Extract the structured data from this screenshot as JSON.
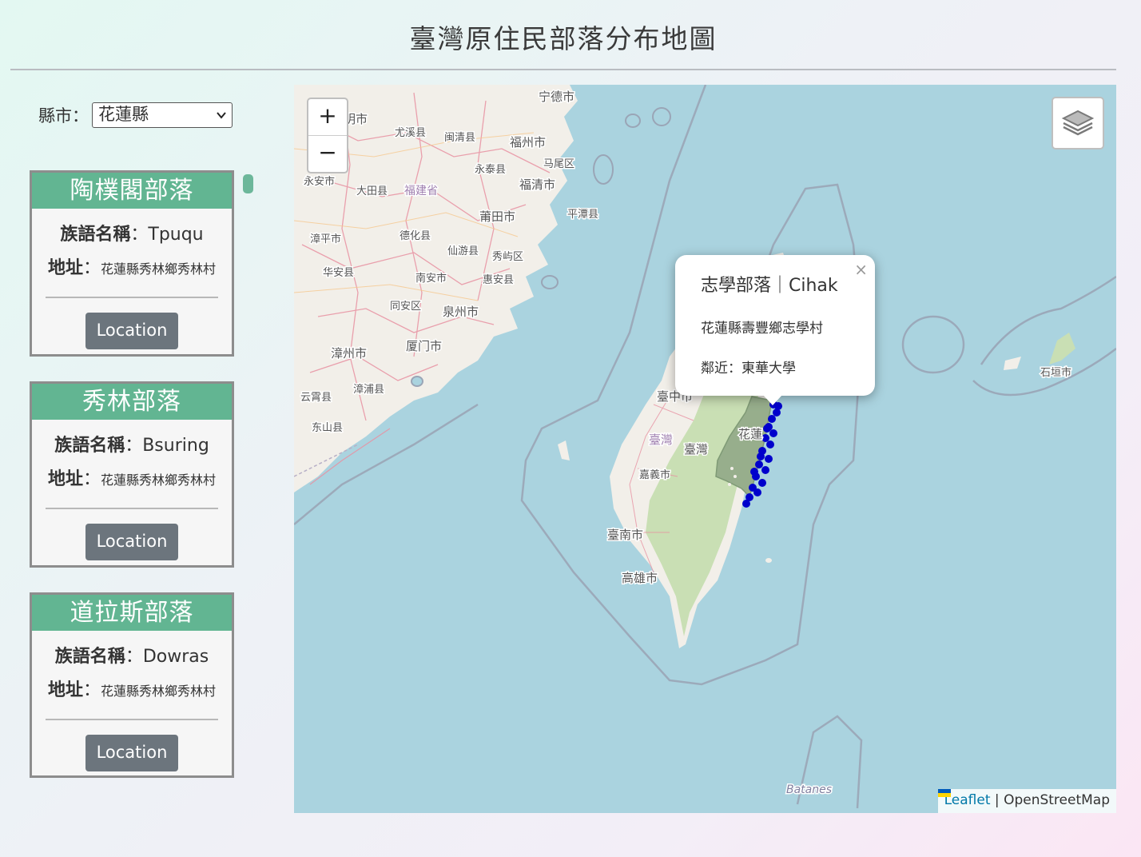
{
  "header": {
    "title": "臺灣原住民部落分布地圖"
  },
  "filter": {
    "label": "縣市：",
    "selected": "花蓮縣"
  },
  "cards": [
    {
      "name": "陶樸閣部落",
      "lang_label": "族語名稱",
      "lang_value": "：Tpuqu",
      "addr_label": "地址",
      "addr_value": "：",
      "addr_text": "花蓮縣秀林鄉秀林村",
      "button": "Location"
    },
    {
      "name": "秀林部落",
      "lang_label": "族語名稱",
      "lang_value": "：Bsuring",
      "addr_label": "地址",
      "addr_value": "：",
      "addr_text": "花蓮縣秀林鄉秀林村",
      "button": "Location"
    },
    {
      "name": "道拉斯部落",
      "lang_label": "族語名稱",
      "lang_value": "：Dowras",
      "addr_label": "地址",
      "addr_value": "：",
      "addr_text": "花蓮縣秀林鄉秀林村",
      "button": "Location"
    }
  ],
  "map": {
    "zoom_in": "+",
    "zoom_out": "−",
    "popup": {
      "title": "志學部落｜Cihak",
      "address": "花蓮縣壽豐鄉志學村",
      "nearby": "鄰近：東華大學",
      "close": "×"
    },
    "attribution": {
      "leaflet": "Leaflet",
      "sep": " | ",
      "osm": "OpenStreetMap"
    },
    "labels": [
      {
        "text": "宁德市"
      },
      {
        "text": "明市"
      },
      {
        "text": "尤溪县"
      },
      {
        "text": "闽清县"
      },
      {
        "text": "福州市"
      },
      {
        "text": "马尾区"
      },
      {
        "text": "永泰县"
      },
      {
        "text": "永安市"
      },
      {
        "text": "大田县"
      },
      {
        "text": "福建省"
      },
      {
        "text": "福清市"
      },
      {
        "text": "莆田市"
      },
      {
        "text": "平潭县"
      },
      {
        "text": "德化县"
      },
      {
        "text": "漳平市"
      },
      {
        "text": "仙游县"
      },
      {
        "text": "秀屿区"
      },
      {
        "text": "华安县"
      },
      {
        "text": "南安市"
      },
      {
        "text": "惠安县"
      },
      {
        "text": "同安区"
      },
      {
        "text": "泉州市"
      },
      {
        "text": "厦门市"
      },
      {
        "text": "漳州市"
      },
      {
        "text": "漳浦县"
      },
      {
        "text": "云霄县"
      },
      {
        "text": "东山县"
      },
      {
        "text": "臺中市"
      },
      {
        "text": "臺灣"
      },
      {
        "text": "臺灣"
      },
      {
        "text": "花蓮"
      },
      {
        "text": "嘉義市"
      },
      {
        "text": "臺南市"
      },
      {
        "text": "高雄市"
      },
      {
        "text": "石垣市"
      },
      {
        "text": "Batanes"
      }
    ],
    "colors": {
      "water": "#aad3df",
      "land": "#f2efe9",
      "forest": "#c9dfb4",
      "highlight": "#97ae8c",
      "marker": "#0000cc",
      "accent": "#62b592"
    }
  }
}
